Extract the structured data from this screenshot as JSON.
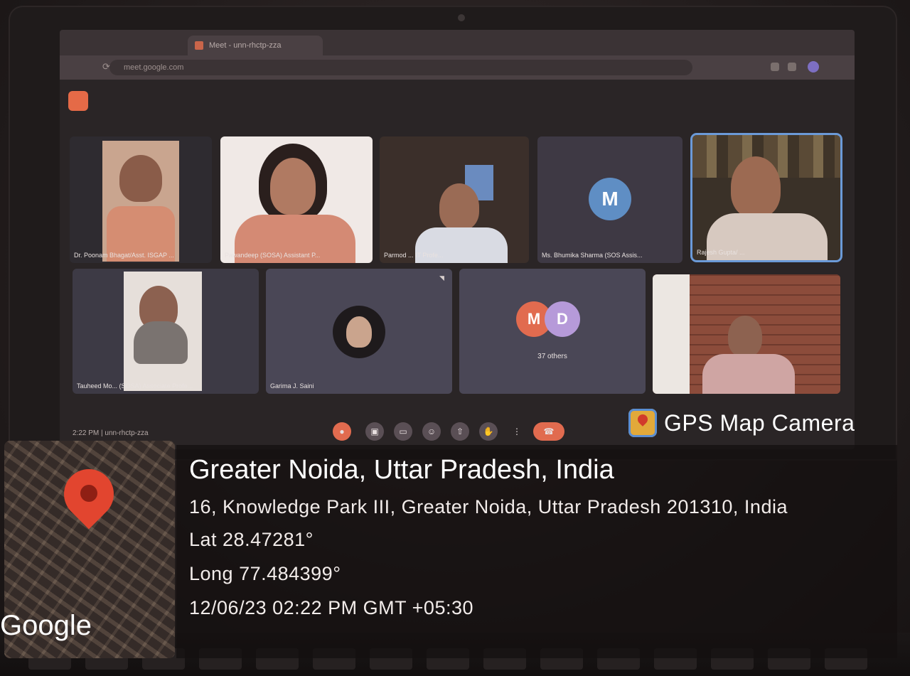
{
  "browser": {
    "tab_title": "Meet - unn-rhctp-zza",
    "url": "meet.google.com"
  },
  "meet": {
    "participants": [
      {
        "name": "Dr. Poonam Bhagat/Asst. ISGAP ..."
      },
      {
        "name": "Pawandeep (SOSA) Assistant P..."
      },
      {
        "name": "Parmod ... IT Profe..."
      },
      {
        "name": "Ms. Bhumika Sharma (SOS Assis..."
      },
      {
        "name": "Rajesh Gupta/ ..."
      },
      {
        "name": "Tauheed Mo... (SOSA) Associate Profe..."
      },
      {
        "name": "Garima J. Saini"
      },
      {
        "name": "37 others"
      },
      {
        "name": ""
      }
    ],
    "avatar_letter_m": "M",
    "avatar_letter_d": "D",
    "meeting_time": "2:22 PM",
    "meeting_code": "unn-rhctp-zza"
  },
  "gps": {
    "brand": "GPS Map Camera",
    "location_title": "Greater Noida, Uttar Pradesh, India",
    "address": "16, Knowledge Park III, Greater Noida, Uttar Pradesh 201310, India",
    "lat": "Lat 28.47281°",
    "long": "Long 77.484399°",
    "timestamp": "12/06/23 02:22 PM GMT +05:30",
    "map_provider": "Google"
  },
  "colors": {
    "pin": "#e2452f",
    "end_call": "#e16b4f",
    "avatar_orange": "#e16b4f",
    "avatar_purple": "#b69ad9",
    "avatar_blue": "#5f8ec4"
  }
}
